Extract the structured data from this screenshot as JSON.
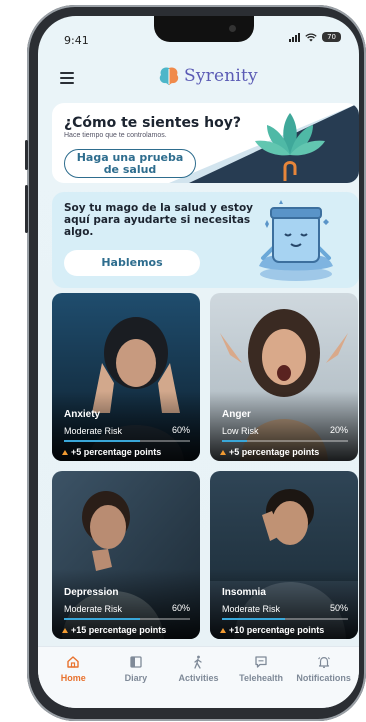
{
  "status_bar": {
    "time": "9:41",
    "battery": "70"
  },
  "header": {
    "brand": "Syrenity"
  },
  "checkin_card": {
    "title": "¿Cómo te sientes hoy?",
    "subtitle": "Hace tiempo que te controlamos.",
    "button_line1": "Haga una prueba",
    "button_line2": "de salud"
  },
  "wizard_card": {
    "text": "Soy tu mago de la salud y estoy aquí para ayudarte si necesitas algo.",
    "button": "Hablemos"
  },
  "risk_cards": [
    {
      "name": "Anxiety",
      "level": "Moderate Risk",
      "percent_label": "60%",
      "percent": 60,
      "delta": "+5 percentage points",
      "bar_color": "#3aa7d9"
    },
    {
      "name": "Anger",
      "level": "Low Risk",
      "percent_label": "20%",
      "percent": 20,
      "delta": "+5 percentage points",
      "bar_color": "#3aa7d9"
    },
    {
      "name": "Depression",
      "level": "Moderate Risk",
      "percent_label": "60%",
      "percent": 60,
      "delta": "+15 percentage points",
      "bar_color": "#3aa7d9"
    },
    {
      "name": "Insomnia",
      "level": "Moderate Risk",
      "percent_label": "50%",
      "percent": 50,
      "delta": "+10 percentage points",
      "bar_color": "#3aa7d9"
    }
  ],
  "nav": {
    "items": [
      {
        "label": "Home",
        "icon": "home-icon",
        "active": true
      },
      {
        "label": "Diary",
        "icon": "book-icon",
        "active": false
      },
      {
        "label": "Activities",
        "icon": "walking-person-icon",
        "active": false
      },
      {
        "label": "Telehealth",
        "icon": "chat-icon",
        "active": false
      },
      {
        "label": "Notifications",
        "icon": "bell-icon",
        "active": false
      }
    ]
  },
  "colors": {
    "accent": "#e8732f",
    "brand": "#5b5bb5",
    "primary": "#2e6d8e",
    "progress": "#3aa7d9"
  }
}
